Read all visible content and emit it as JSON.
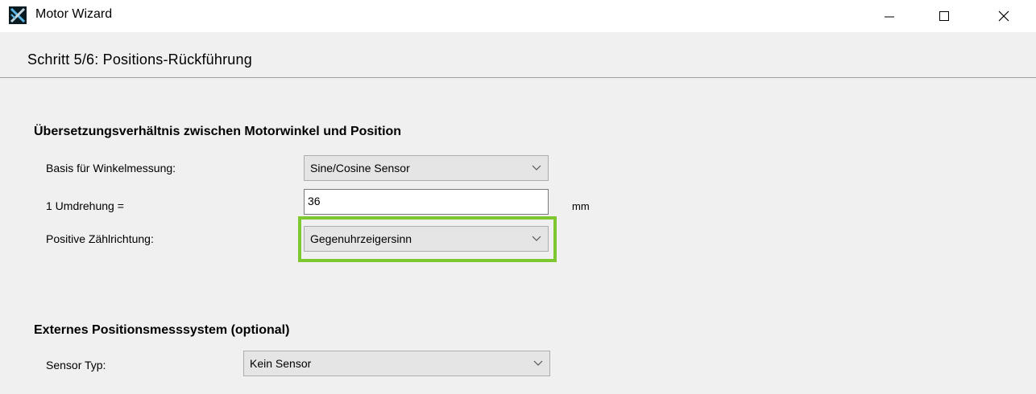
{
  "window": {
    "title": "Motor Wizard",
    "icon": "motor-wizard-app-icon",
    "controls": [
      "minimize-icon",
      "maximize-icon",
      "close-icon"
    ]
  },
  "step": {
    "title": "Schritt 5/6: Positions-Rückführung"
  },
  "ratio_section": {
    "title": "Übersetzungsverhältnis zwischen Motorwinkel und Position",
    "angle_basis": {
      "label": "Basis für Winkelmessung:",
      "value": "Sine/Cosine Sensor"
    },
    "revolution": {
      "label": "1 Umdrehung  =",
      "value": "36",
      "unit": "mm"
    },
    "count_direction": {
      "label": "Positive Zählrichtung:",
      "value": "Gegenuhrzeigersinn",
      "highlight_color": "#7dc82e"
    }
  },
  "external_section": {
    "title": "Externes Positionsmesssystem (optional)",
    "sensor_type": {
      "label": "Sensor Typ:",
      "value": "Kein Sensor"
    }
  }
}
